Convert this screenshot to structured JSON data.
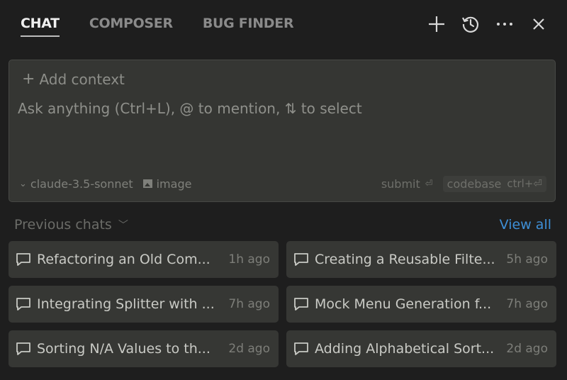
{
  "tabs": [
    {
      "label": "CHAT",
      "active": true
    },
    {
      "label": "COMPOSER",
      "active": false
    },
    {
      "label": "BUG FINDER",
      "active": false
    }
  ],
  "header_actions": [
    "plus-icon",
    "history-icon",
    "more-icon",
    "close-icon"
  ],
  "input": {
    "add_context": "Add context",
    "placeholder": "Ask anything (Ctrl+L), @ to mention, ⇅ to select",
    "model": "claude-3.5-sonnet",
    "image_label": "image",
    "submit_label": "submit",
    "submit_key": "⏎",
    "codebase_label": "codebase",
    "codebase_key": "ctrl+⏎"
  },
  "previous_chats": {
    "title": "Previous chats",
    "view_all": "View all",
    "items": [
      {
        "title": "Refactoring an Old Com...",
        "time": "1h ago"
      },
      {
        "title": "Creating a Reusable Filte...",
        "time": "5h ago"
      },
      {
        "title": "Integrating Splitter with ...",
        "time": "7h ago"
      },
      {
        "title": "Mock Menu Generation f...",
        "time": "7h ago"
      },
      {
        "title": "Sorting N/A Values to th...",
        "time": "2d ago"
      },
      {
        "title": "Adding Alphabetical Sort...",
        "time": "2d ago"
      }
    ]
  },
  "colors": {
    "background": "#1e1e1e",
    "panel": "#353633",
    "accent_link": "#3e8fd6"
  }
}
